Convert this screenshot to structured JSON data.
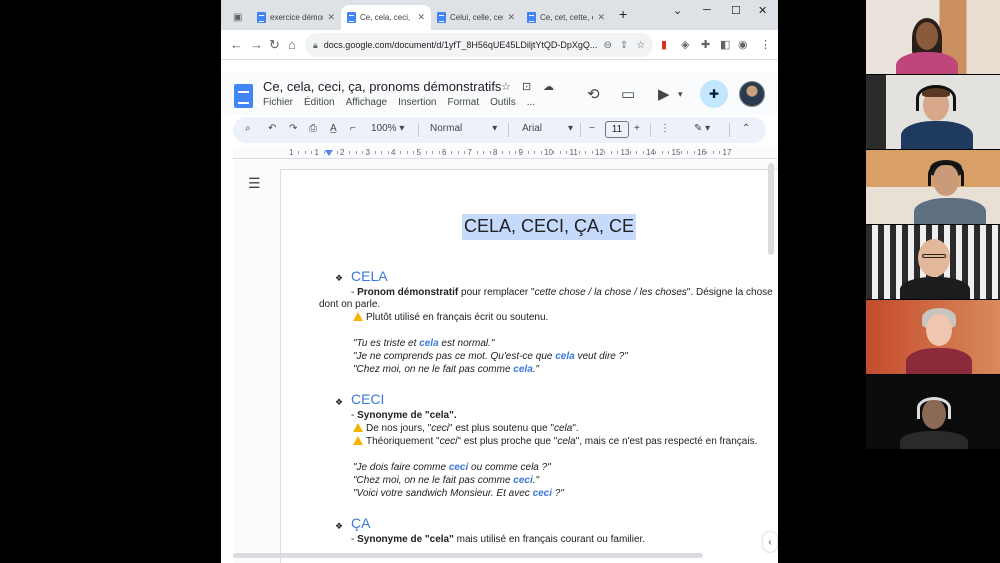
{
  "browser": {
    "tabs": [
      {
        "title": "exercice démonstratifs",
        "active": false
      },
      {
        "title": "Ce, cela, ceci, ça, pronoms démonstratifs",
        "active": true
      },
      {
        "title": "Celui, celle, ceux, celles",
        "active": false
      },
      {
        "title": "Ce, cet, cette, ces",
        "active": false
      }
    ],
    "new_tab": "+",
    "window_controls": {
      "minimize": "─",
      "maximize": "☐",
      "close": "✕",
      "menu": "⌄"
    },
    "url": "docs.google.com/document/d/1yfT_8H56qUE45LDiljtYtQD-DpXgQ..."
  },
  "docs": {
    "title": "Ce, cela, ceci, ça, pronoms démonstratifs",
    "menu": [
      "Fichier",
      "Édition",
      "Affichage",
      "Insertion",
      "Format",
      "Outils",
      "..."
    ],
    "toolbar": {
      "zoom": "100%",
      "style": "Normal",
      "font": "Arial",
      "font_size": "11",
      "minus": "−",
      "plus": "+"
    },
    "ruler_numbers": [
      "1",
      "1",
      "2",
      "3",
      "4",
      "5",
      "6",
      "7",
      "8",
      "9",
      "10",
      "11",
      "12",
      "13",
      "14",
      "15",
      "16",
      "17"
    ]
  },
  "document": {
    "heading": "CELA, CECI, ÇA, CE",
    "bullet": "❖",
    "cela": {
      "title": "CELA",
      "l1_dash": "- ",
      "l1_bold": "Pronom démonstratif",
      "l1_rest": " pour remplacer \"",
      "l1_italic": "cette chose / la chose / les choses",
      "l1_end": "\". Désigne la chose",
      "l2": "dont on parle.",
      "note": "Plutôt utilisé en français écrit ou soutenu.",
      "ex1_a": "\"Tu es triste et ",
      "ex1_b": "cela",
      "ex1_c": " est normal.\"",
      "ex2_a": "\"Je ne comprends pas ce mot. Qu'est-ce que ",
      "ex2_b": "cela",
      "ex2_c": " veut dire ?\"",
      "ex3_a": "\"Chez moi, on ne le fait pas comme ",
      "ex3_b": "cela",
      "ex3_c": ".\""
    },
    "ceci": {
      "title": "CECI",
      "syn_dash": "- ",
      "syn_bold": "Synonyme de \"cela\".",
      "n1_a": "De nos jours, \"",
      "n1_b": "ceci",
      "n1_c": "\" est plus soutenu que \"",
      "n1_d": "cela",
      "n1_e": "\".",
      "n2_a": "Théoriquement \"",
      "n2_b": "ceci",
      "n2_c": "\" est plus proche que \"",
      "n2_d": "cela",
      "n2_e": "\", mais ce n'est pas respecté en français.",
      "ex1_a": "\"Je dois faire comme ",
      "ex1_b": "ceci",
      "ex1_c": " ou comme cela ?\"",
      "ex2_a": "\"Chez moi, on ne le fait pas comme ",
      "ex2_b": "ceci",
      "ex2_c": ".\"",
      "ex3_a": "\"Voici votre sandwich Monsieur. Et avec ",
      "ex3_b": "ceci",
      "ex3_c": " ?\""
    },
    "ca": {
      "title": "ÇA",
      "syn_dash": "- ",
      "syn_bold": "Synonyme de \"cela\"",
      "syn_rest": " mais utilisé en français courant ou familier."
    }
  },
  "colors": {
    "accent": "#3c78d8",
    "selection": "#c6dafc",
    "toolbar": "#edf2fa",
    "tabstrip": "#dee1e6"
  },
  "participants": [
    "participant-1",
    "participant-2",
    "participant-3",
    "participant-4",
    "participant-5",
    "participant-6"
  ]
}
